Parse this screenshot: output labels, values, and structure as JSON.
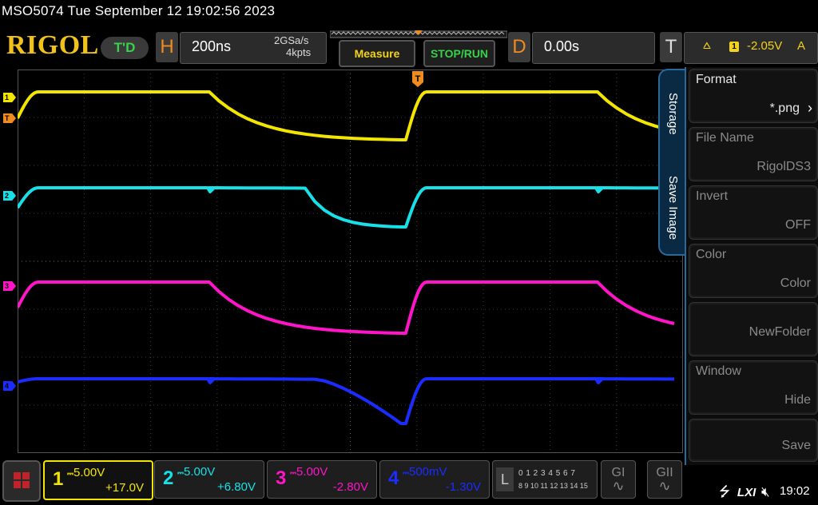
{
  "header": {
    "title": "MSO5074  Tue September 12 19:02:56 2023",
    "logo": "RIGOL",
    "status_badge": "T'D"
  },
  "horizontal": {
    "letter": "H",
    "time_per_div": "200ns",
    "sample_rate": "2GSa/s",
    "memory_depth": "4kpts"
  },
  "toolbar": {
    "measure_label": "Measure",
    "stoprun_label": "STOP/RUN"
  },
  "delay": {
    "letter": "D",
    "value": "0.00s"
  },
  "trigger": {
    "letter": "T",
    "source": "1",
    "level": "-2.05V",
    "mode": "A"
  },
  "channels": [
    {
      "num": "1",
      "scale": "5.00V",
      "offset": "+17.0V",
      "color": "#f2e600",
      "marker_label": "1"
    },
    {
      "num": "2",
      "scale": "5.00V",
      "offset": "+6.80V",
      "color": "#18e0e8",
      "marker_label": "2"
    },
    {
      "num": "3",
      "scale": "5.00V",
      "offset": "-2.80V",
      "color": "#ff14c8",
      "marker_label": "3"
    },
    {
      "num": "4",
      "scale": "500mV",
      "offset": "-1.30V",
      "color": "#1a2cff",
      "marker_label": "4"
    }
  ],
  "trigger_marker_label": "T",
  "side_menu": {
    "tabs": [
      "Storage",
      "Save Image"
    ],
    "items": [
      {
        "label": "Format",
        "value": "*.png"
      },
      {
        "label": "File Name",
        "value": "RigolDS3"
      },
      {
        "label": "Invert",
        "value": "OFF"
      },
      {
        "label": "Color",
        "value": "Color"
      },
      {
        "label": "",
        "value": "NewFolder"
      },
      {
        "label": "Window",
        "value": "Hide"
      },
      {
        "label": "",
        "value": "Save"
      }
    ]
  },
  "logic": {
    "letter": "L",
    "row1": "0 1 2 3  4 5 6 7",
    "row2": "8 9 10 11 12 13 14 15"
  },
  "generators": [
    "GI",
    "GII"
  ],
  "status": {
    "lxi": "LXI",
    "clock": "19:02"
  }
}
